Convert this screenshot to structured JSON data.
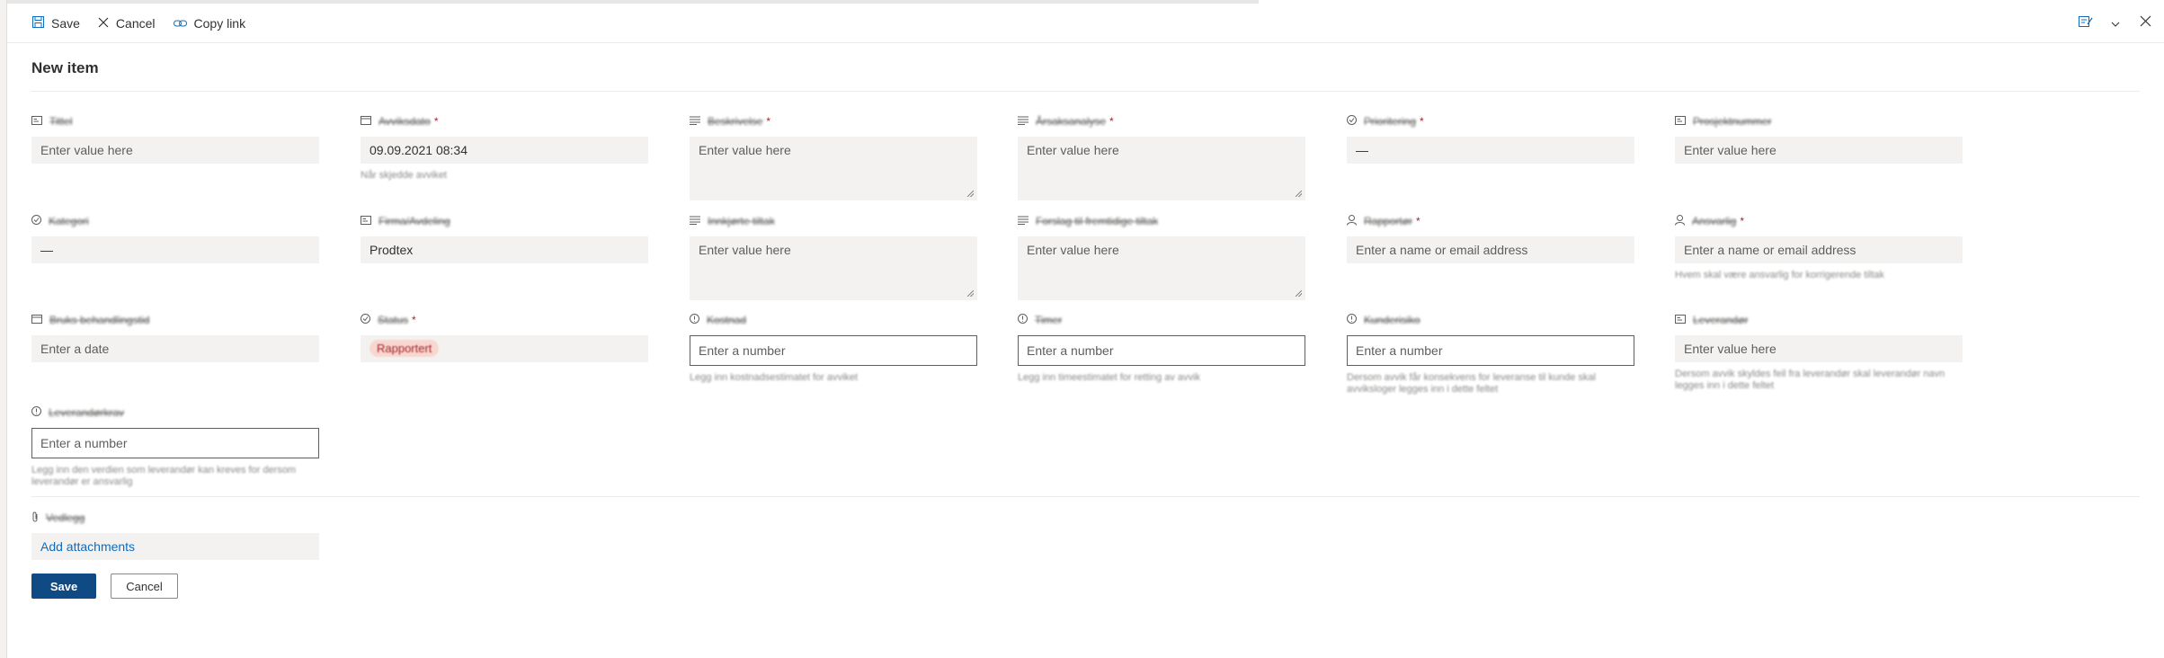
{
  "toolbar": {
    "save_label": "Save",
    "cancel_label": "Cancel",
    "copy_link_label": "Copy link"
  },
  "form": {
    "title": "New item",
    "fields": [
      {
        "label": "Tittel",
        "required": false,
        "placeholder": "Enter value here",
        "value": ""
      },
      {
        "label": "Avviksdato",
        "required": true,
        "value": "09.09.2021 08:34",
        "help": "Når skjedde avviket"
      },
      {
        "label": "Beskrivelse",
        "required": true,
        "placeholder": "Enter value here"
      },
      {
        "label": "Årsaksanalyse",
        "required": true,
        "placeholder": "Enter value here"
      },
      {
        "label": "Prioritering",
        "required": true,
        "value": "—"
      },
      {
        "label": "Prosjektnummer",
        "required": false,
        "placeholder": "Enter value here"
      },
      {
        "label": "Kategori",
        "required": false,
        "value": "—"
      },
      {
        "label": "Firma/Avdeling",
        "required": false,
        "value": "Prodtex"
      },
      {
        "label": "Innkjørte tiltak",
        "required": false,
        "placeholder": "Enter value here"
      },
      {
        "label": "Forslag til fremtidige tiltak",
        "required": false,
        "placeholder": "Enter value here"
      },
      {
        "label": "Rapportør",
        "required": true,
        "placeholder": "Enter a name or email address"
      },
      {
        "label": "Ansvarlig",
        "required": true,
        "placeholder": "Enter a name or email address",
        "help": "Hvem skal være ansvarlig for korrigerende tiltak"
      },
      {
        "label": "Bruks behandlingstid",
        "required": false,
        "placeholder": "Enter a date"
      },
      {
        "label": "Status",
        "required": true,
        "value": "Rapportert"
      },
      {
        "label": "Kostnad",
        "required": false,
        "placeholder": "Enter a number",
        "help": "Legg inn kostnadsestimatet for avviket"
      },
      {
        "label": "Timer",
        "required": false,
        "placeholder": "Enter a number",
        "help": "Legg inn timeestimatet for retting av avvik"
      },
      {
        "label": "Kunderisiko",
        "required": false,
        "placeholder": "Enter a number",
        "help": "Dersom avvik får konsekvens for leveranse til kunde skal avviksloger legges inn i dette feltet"
      },
      {
        "label": "Leverandør",
        "required": false,
        "placeholder": "Enter value here",
        "help": "Dersom avvik skyldes feil fra leverandør skal leverandør navn legges inn i dette feltet"
      },
      {
        "label": "Leverandørkrav",
        "required": false,
        "placeholder": "Enter a number",
        "help": "Legg inn den verdien som leverandør kan kreves for dersom leverandør er ansvarlig"
      }
    ],
    "attachments": {
      "label": "Vedlegg",
      "link_label": "Add attachments"
    },
    "save_button": "Save",
    "cancel_button": "Cancel"
  }
}
